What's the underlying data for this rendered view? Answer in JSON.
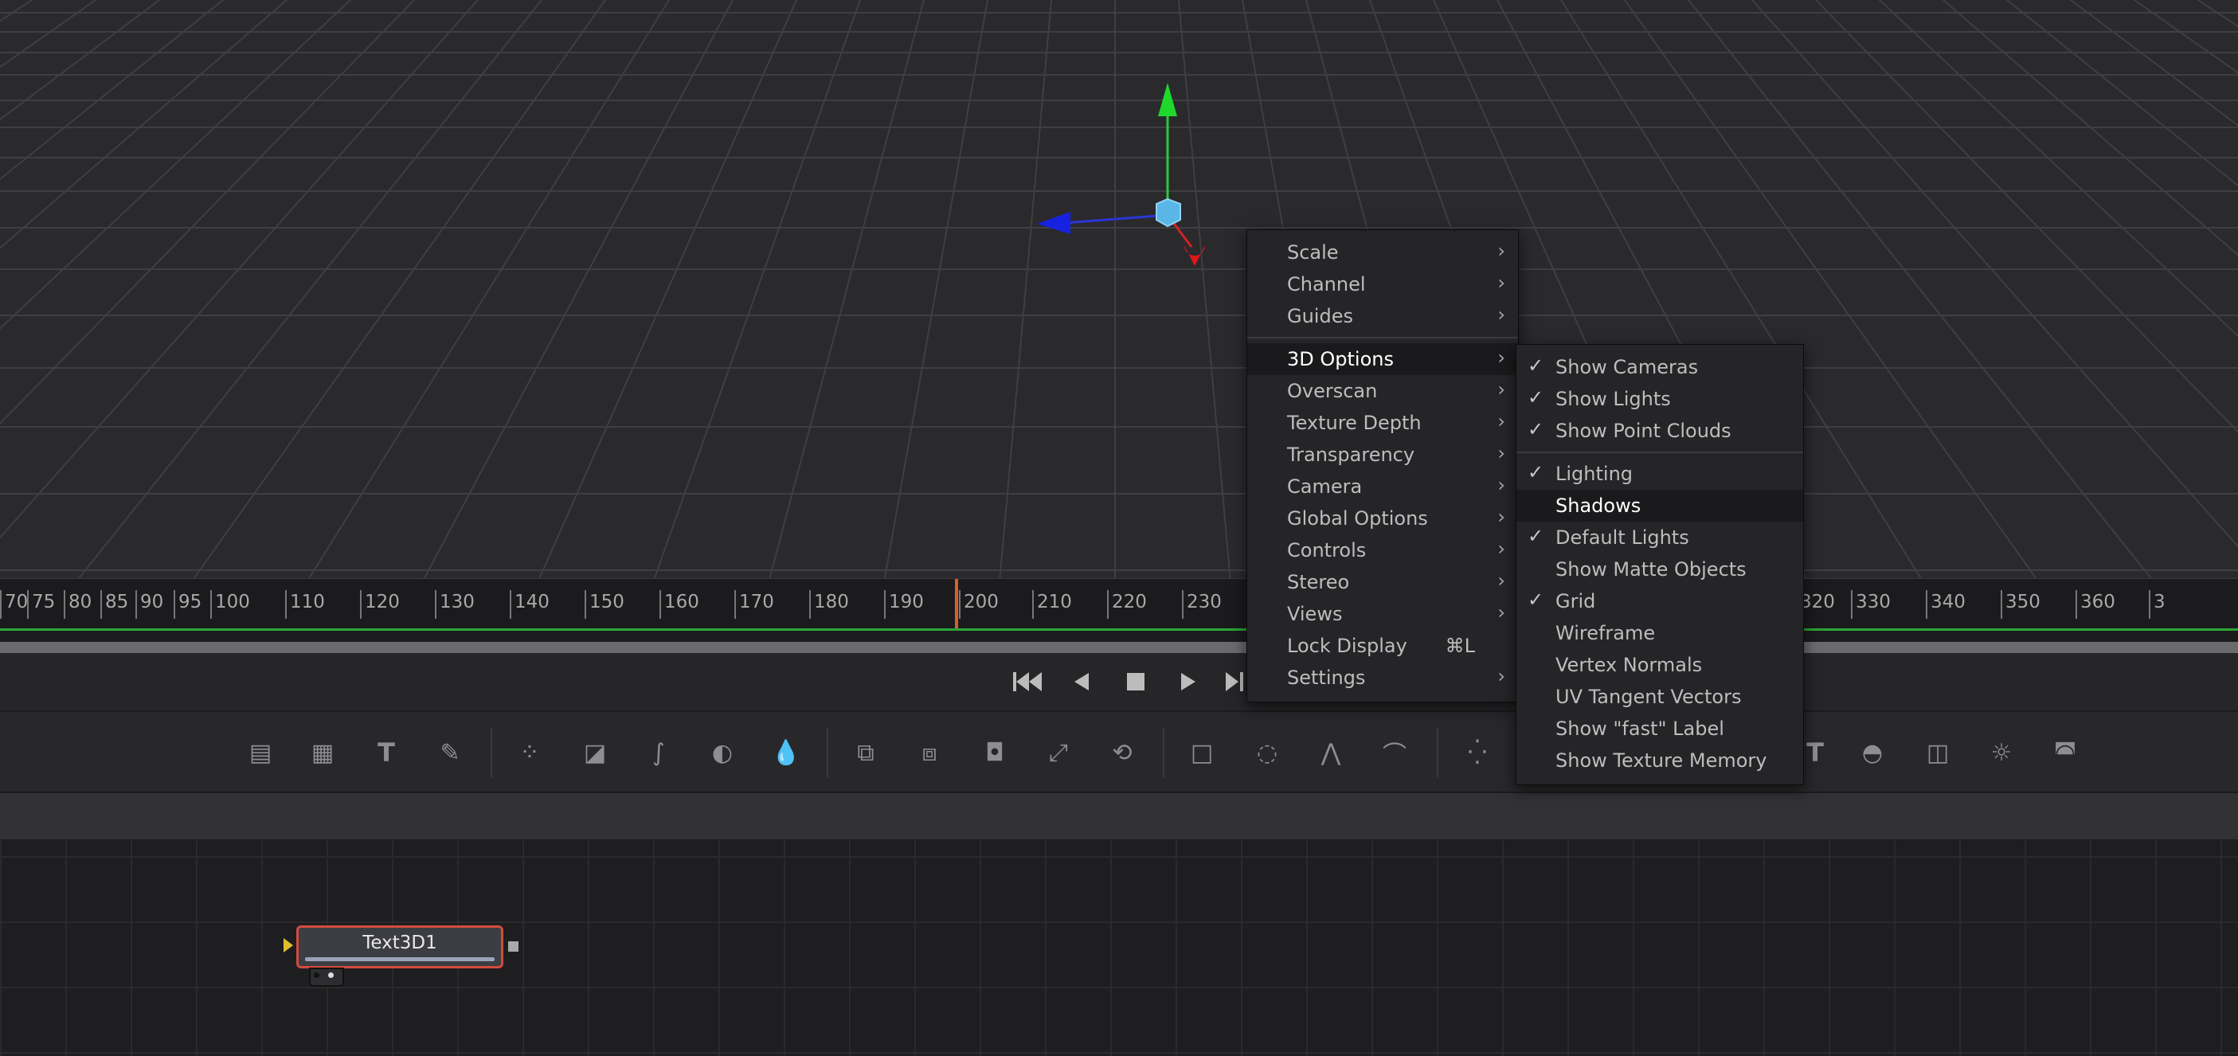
{
  "ruler": {
    "labels": [
      "70",
      "75",
      "80",
      "85",
      "90",
      "95",
      "100",
      "110",
      "120",
      "130",
      "140",
      "150",
      "160",
      "170",
      "180",
      "190",
      "200",
      "210",
      "220",
      "230",
      "320",
      "330",
      "340",
      "350",
      "360",
      "3"
    ]
  },
  "transport": {
    "first_icon": "skip-to-start-icon",
    "prev_icon": "step-back-icon",
    "stop_icon": "stop-icon",
    "play_icon": "play-icon",
    "last_icon": "skip-to-end-icon"
  },
  "toolbar": {
    "icons": [
      "background-icon",
      "fast-noise-icon",
      "text-icon",
      "paint-icon",
      "particles-icon",
      "color-curves-icon",
      "brightness-contrast-icon",
      "color-corrector-icon",
      "blur-icon",
      "merge-icon",
      "channel-boolean-icon",
      "matte-control-icon",
      "transform-icon",
      "loader-icon",
      "rectangle-mask-icon",
      "ellipse-mask-icon",
      "polygon-mask-icon",
      "bspline-mask-icon",
      "pemitter-icon",
      "text3d-icon",
      "shape3d-icon",
      "merge3d-icon",
      "spot-light-icon",
      "renderer3d-icon"
    ]
  },
  "node": {
    "label": "Text3D1"
  },
  "menu": {
    "items": [
      {
        "label": "Scale",
        "submenu": true
      },
      {
        "label": "Channel",
        "submenu": true
      },
      {
        "label": "Guides",
        "submenu": true
      },
      {
        "label": "3D Options",
        "submenu": true,
        "highlighted": true
      },
      {
        "label": "Overscan",
        "submenu": true
      },
      {
        "label": "Texture Depth",
        "submenu": true
      },
      {
        "label": "Transparency",
        "submenu": true
      },
      {
        "label": "Camera",
        "submenu": true
      },
      {
        "label": "Global Options",
        "submenu": true
      },
      {
        "label": "Controls",
        "submenu": true
      },
      {
        "label": "Stereo",
        "submenu": true
      },
      {
        "label": "Views",
        "submenu": true
      },
      {
        "label": "Lock Display",
        "shortcut": "⌘L"
      },
      {
        "label": "Settings",
        "submenu": true
      }
    ]
  },
  "submenu": {
    "items": [
      {
        "label": "Show Cameras",
        "checked": true
      },
      {
        "label": "Show Lights",
        "checked": true
      },
      {
        "label": "Show Point Clouds",
        "checked": true
      },
      {
        "label": "Lighting",
        "checked": true
      },
      {
        "label": "Shadows",
        "checked": false,
        "highlighted": true
      },
      {
        "label": "Default Lights",
        "checked": true
      },
      {
        "label": "Show Matte Objects",
        "checked": false
      },
      {
        "label": "Grid",
        "checked": true
      },
      {
        "label": "Wireframe",
        "checked": false
      },
      {
        "label": "Vertex Normals",
        "checked": false
      },
      {
        "label": "UV Tangent Vectors",
        "checked": false
      },
      {
        "label": "Show \"fast\" Label",
        "checked": false
      },
      {
        "label": "Show Texture Memory",
        "checked": false
      }
    ]
  }
}
